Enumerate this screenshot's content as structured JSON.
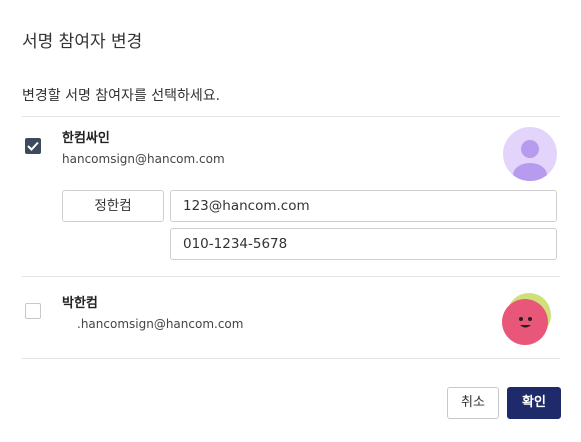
{
  "dialog": {
    "title": "서명 참여자 변경",
    "instruction": "변경할 서명 참여자를 선택하세요."
  },
  "signers": [
    {
      "name": "한컴싸인",
      "email": "hancomsign@hancom.com",
      "checked": true,
      "edit": {
        "name_value": "정한컴",
        "email_value": "123@hancom.com",
        "phone_value": "010-1234-5678"
      }
    },
    {
      "name": "박한컴",
      "email": ".hancomsign@hancom.com",
      "checked": false
    }
  ],
  "buttons": {
    "cancel_label": "취소",
    "confirm_label": "확인"
  },
  "colors": {
    "primary": "#1f2a6b",
    "checkbox_checked": "#3d4a5c",
    "avatar1_bg": "#d9c8f7",
    "avatar2_bg": "#e8567a"
  }
}
